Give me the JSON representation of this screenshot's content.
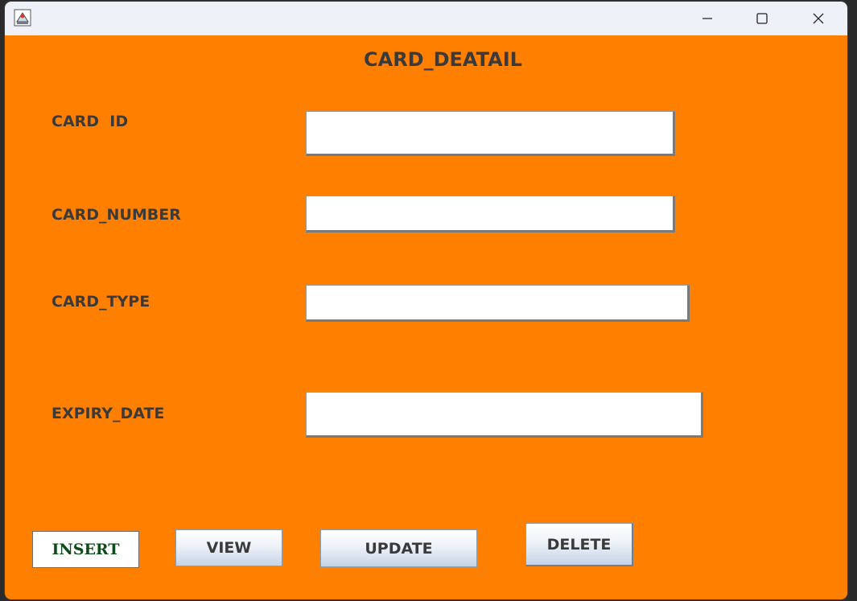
{
  "window": {
    "title": "",
    "controls": {
      "minimize": "minimize-icon",
      "maximize": "maximize-icon",
      "close": "close-icon"
    }
  },
  "form": {
    "heading": "CARD_DEATAIL",
    "fields": {
      "card_id": {
        "label": "CARD  ID",
        "value": ""
      },
      "card_number": {
        "label": "CARD_NUMBER",
        "value": ""
      },
      "card_type": {
        "label": "CARD_TYPE",
        "value": ""
      },
      "expiry_date": {
        "label": "EXPIRY_DATE",
        "value": ""
      }
    }
  },
  "buttons": {
    "insert": "INSERT",
    "view": "VIEW",
    "update": "UPDATE",
    "delete": "DELETE"
  },
  "colors": {
    "background": "#ff8000",
    "titlebar": "#eef1f8",
    "label_text": "#3a3a3a",
    "insert_text": "#0f4a1a"
  }
}
